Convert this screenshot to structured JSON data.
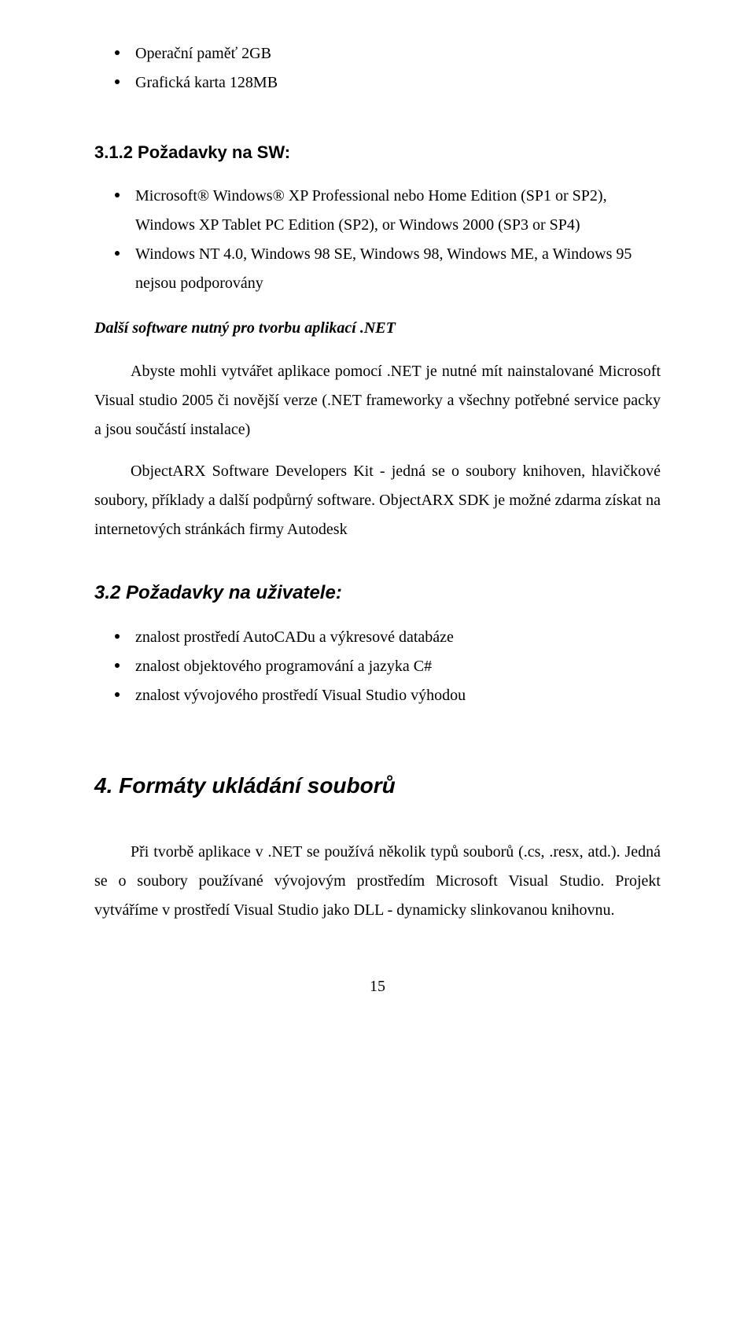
{
  "topBullets": {
    "items": [
      {
        "text": "Operační paměť 2GB"
      },
      {
        "text": "Grafická karta 128MB"
      }
    ]
  },
  "section312": {
    "heading": "3.1.2 Požadavky na SW:",
    "bullets": [
      {
        "text": "Microsoft® Windows® XP Professional nebo Home Edition (SP1 or SP2), Windows XP Tablet PC Edition (SP2), or Windows 2000 (SP3 or SP4)"
      },
      {
        "text": "Windows NT 4.0, Windows 98 SE, Windows 98, Windows ME, a Windows 95 nejsou podporovány"
      }
    ],
    "subheadItalic": "Další software nutný pro tvorbu aplikací .NET",
    "para1": "Abyste mohli vytvářet aplikace pomocí .NET je nutné mít nainstalované Microsoft  Visual studio 2005 či novější verze (.NET frameworky  a všechny potřebné service packy a jsou součástí instalace)",
    "para2": "ObjectARX Software Developers Kit - jedná se o soubory knihoven, hlavičkové soubory, příklady a další podpůrný software. ObjectARX SDK je možné zdarma získat na internetových stránkách firmy Autodesk"
  },
  "section32": {
    "heading": "3.2 Požadavky na uživatele:",
    "bullets": [
      {
        "text": "znalost prostředí AutoCADu a výkresové databáze"
      },
      {
        "text": "znalost objektového programování a jazyka C#"
      },
      {
        "text": "znalost vývojového prostředí Visual Studio výhodou"
      }
    ]
  },
  "section4": {
    "heading": "4. Formáty ukládání souborů",
    "para": "Při tvorbě aplikace v .NET se používá několik typů souborů (.cs, .resx,  atd.). Jedná se o soubory používané vývojovým prostředím Microsoft Visual Studio. Projekt vytváříme v prostředí Visual Studio jako DLL - dynamicky slinkovanou knihovnu."
  },
  "pageNumber": "15"
}
